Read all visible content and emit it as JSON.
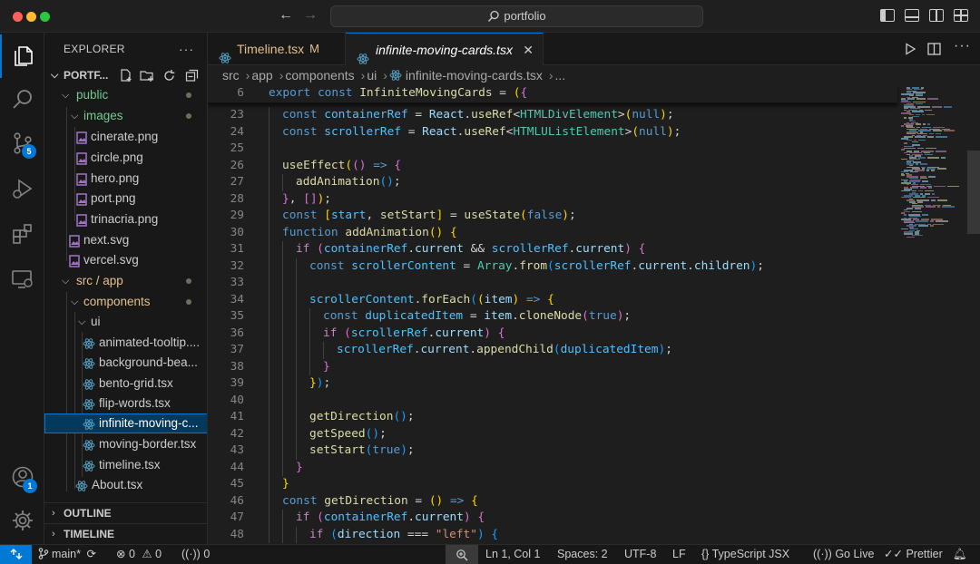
{
  "window": {
    "search_text": "portfolio"
  },
  "activity_bar": {
    "source_control_badge": "5",
    "accounts_badge": "1"
  },
  "explorer": {
    "title": "EXPLORER",
    "root": "PORTF...",
    "items": [
      {
        "label": "public",
        "kind": "folder"
      },
      {
        "label": "images",
        "kind": "folder"
      },
      {
        "label": "cinerate.png",
        "kind": "image"
      },
      {
        "label": "circle.png",
        "kind": "image"
      },
      {
        "label": "hero.png",
        "kind": "image"
      },
      {
        "label": "port.png",
        "kind": "image"
      },
      {
        "label": "trinacria.png",
        "kind": "image"
      },
      {
        "label": "next.svg",
        "kind": "svg"
      },
      {
        "label": "vercel.svg",
        "kind": "svg"
      },
      {
        "label": "src / app",
        "kind": "folder"
      },
      {
        "label": "components",
        "kind": "folder"
      },
      {
        "label": "ui",
        "kind": "folder"
      },
      {
        "label": "animated-tooltip....",
        "kind": "react"
      },
      {
        "label": "background-bea...",
        "kind": "react"
      },
      {
        "label": "bento-grid.tsx",
        "kind": "react"
      },
      {
        "label": "flip-words.tsx",
        "kind": "react"
      },
      {
        "label": "infinite-moving-c...",
        "kind": "react"
      },
      {
        "label": "moving-border.tsx",
        "kind": "react"
      },
      {
        "label": "timeline.tsx",
        "kind": "react"
      },
      {
        "label": "About.tsx",
        "kind": "react"
      }
    ],
    "outline_label": "OUTLINE",
    "timeline_label": "TIMELINE"
  },
  "tabs": [
    {
      "label": "Timeline.tsx",
      "modified": "M"
    },
    {
      "label": "infinite-moving-cards.tsx",
      "close": "✕"
    }
  ],
  "breadcrumb": [
    "src",
    "app",
    "components",
    "ui",
    "infinite-moving-cards.tsx",
    "..."
  ],
  "editor": {
    "sticky_line_number": "6",
    "line_numbers": [
      "23",
      "24",
      "25",
      "26",
      "27",
      "28",
      "29",
      "30",
      "31",
      "32",
      "33",
      "34",
      "35",
      "36",
      "37",
      "38",
      "39",
      "40",
      "41",
      "42",
      "43",
      "44",
      "45",
      "46",
      "47",
      "48"
    ]
  },
  "status_bar": {
    "branch": "main*",
    "errors": "0",
    "warnings": "0",
    "ports": "0",
    "cursor": "Ln 1, Col 1",
    "spaces": "Spaces: 2",
    "encoding": "UTF-8",
    "eol": "LF",
    "language": "TypeScript JSX",
    "go_live": "Go Live",
    "prettier": "Prettier"
  },
  "colors": {
    "accent": "#0078d4",
    "modified_tab": "#e2c08d",
    "react_icon": "#519aba"
  }
}
